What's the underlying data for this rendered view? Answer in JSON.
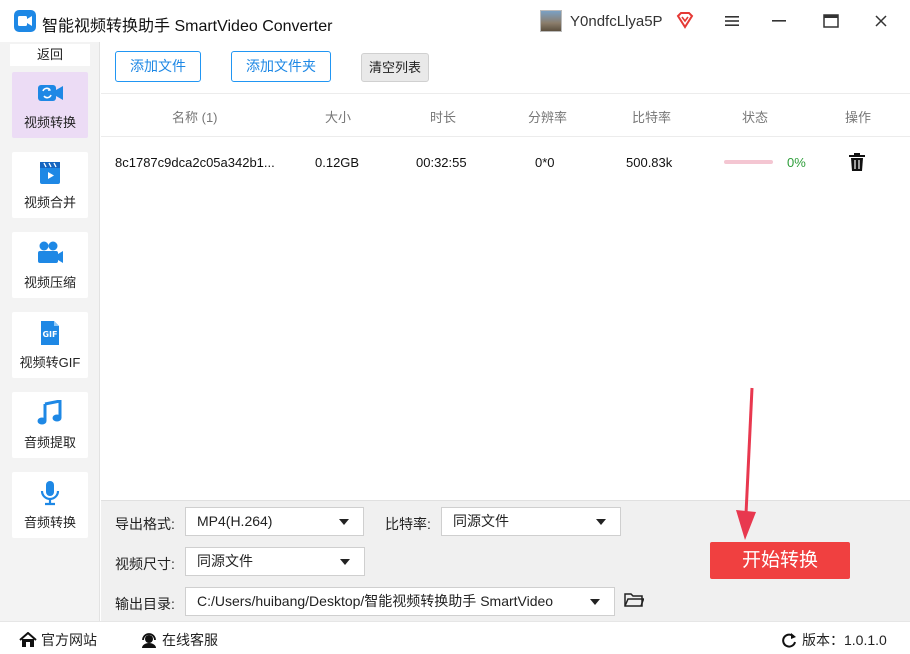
{
  "window": {
    "title": "智能视频转换助手 SmartVideo Converter",
    "username": "Y0ndfcLlya5P"
  },
  "sidebar": {
    "back_label": "返回",
    "items": [
      {
        "label": "视频转换",
        "icon": "video-convert-icon",
        "active": true
      },
      {
        "label": "视频合并",
        "icon": "video-merge-icon",
        "active": false
      },
      {
        "label": "视频压缩",
        "icon": "video-compress-icon",
        "active": false
      },
      {
        "label": "视频转GIF",
        "icon": "gif-icon",
        "active": false
      },
      {
        "label": "音频提取",
        "icon": "music-note-icon",
        "active": false
      },
      {
        "label": "音频转换",
        "icon": "microphone-icon",
        "active": false
      }
    ]
  },
  "toolbar": {
    "add_file": "添加文件",
    "add_folder": "添加文件夹",
    "clear_list": "清空列表"
  },
  "table": {
    "headers": [
      "名称 (1)",
      "大小",
      "时长",
      "分辨率",
      "比特率",
      "状态",
      "操作"
    ],
    "rows": [
      {
        "name": "8c1787c9dca2c05a342b1...",
        "size": "0.12GB",
        "duration": "00:32:55",
        "resolution": "0*0",
        "bitrate": "500.83k",
        "progress": 0,
        "progress_label": "0%"
      }
    ]
  },
  "settings": {
    "format_label": "导出格式:",
    "format_value": "MP4(H.264)",
    "bitrate_label": "比特率:",
    "bitrate_value": "同源文件",
    "size_label": "视频尺寸:",
    "size_value": "同源文件",
    "output_label": "输出目录:",
    "output_value": "C:/Users/huibang/Desktop/智能视频转换助手 SmartVideo",
    "start_button": "开始转换"
  },
  "footer": {
    "website": "官方网站",
    "support": "在线客服",
    "version": "版本：1.0.1.0"
  },
  "colors": {
    "accent": "#1e88e5",
    "start_button": "#f04040",
    "sidebar_active": "#ecdcf5",
    "progress_track": "#f4c6d2",
    "progress_text": "#2e9e3a"
  }
}
